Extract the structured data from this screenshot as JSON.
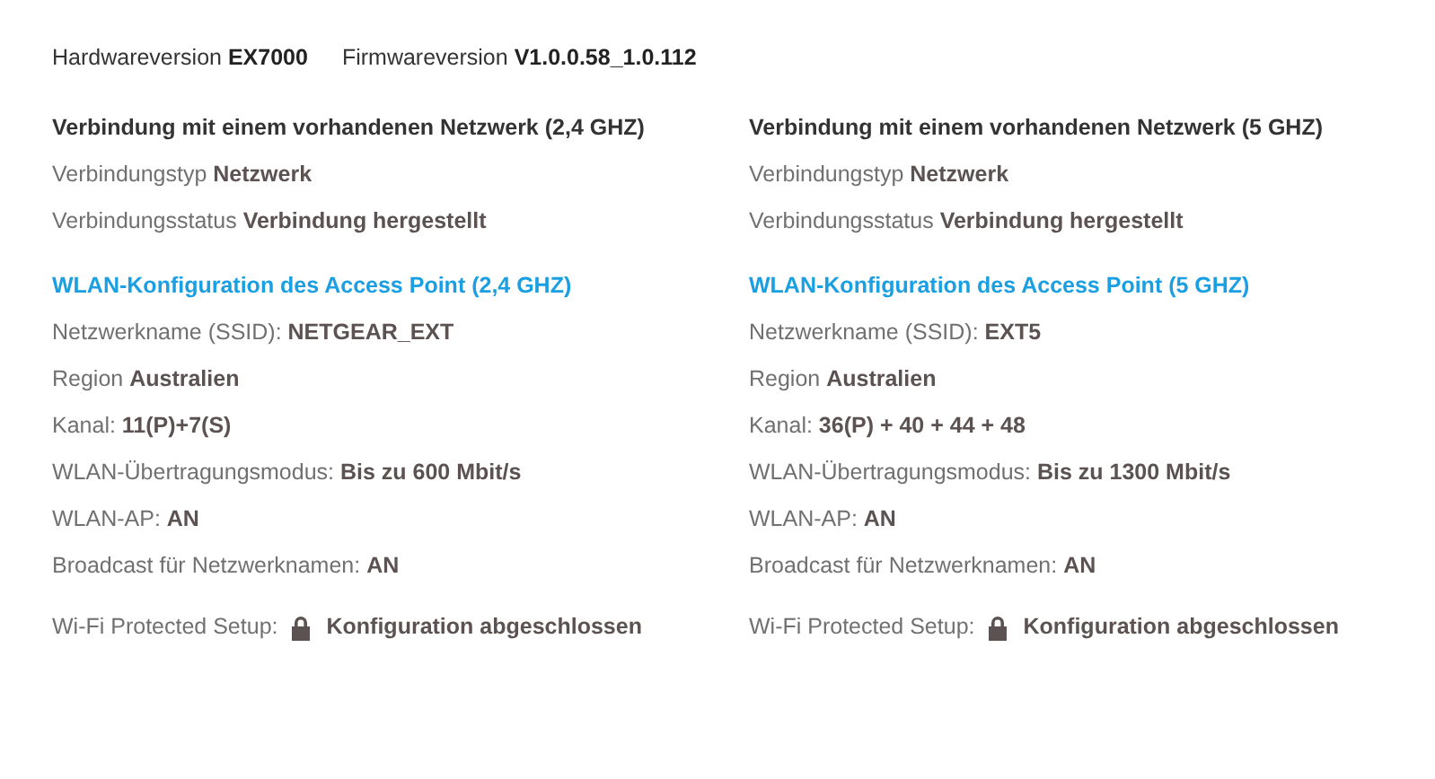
{
  "header": [
    {
      "text": "Hardwareversion **EX7000**"
    },
    {
      "text": "Firmwareversion **V1.0.0.58_1.0.112**"
    }
  ],
  "columns": [
    {
      "connection_title": "Verbindung mit einem vorhandenen Netzwerk (2,4 GHZ)",
      "connection_rows": [
        "Verbindungstyp **Netzwerk**",
        "Verbindungsstatus **Verbindung hergestellt**"
      ],
      "wlan_title": "WLAN-Konfiguration des Access Point (2,4 GHZ)",
      "wlan_rows": [
        "Netzwerkname (SSID): **NETGEAR_EXT**",
        "Region **Australien**",
        "Kanal: **11(P)+7(S)**",
        "WLAN-Übertragungsmodus: **Bis zu 600 Mbit/s**",
        "WLAN-AP: **AN**",
        "Broadcast für Netzwerknamen: **AN**"
      ],
      "wps": {
        "label": "Wi-Fi Protected Setup:",
        "value": "Konfiguration abgeschlossen"
      }
    },
    {
      "connection_title": "Verbindung mit einem vorhandenen Netzwerk (5 GHZ)",
      "connection_rows": [
        "Verbindungstyp **Netzwerk**",
        "Verbindungsstatus **Verbindung hergestellt**"
      ],
      "wlan_title": "WLAN-Konfiguration des Access Point (5 GHZ)",
      "wlan_rows": [
        "Netzwerkname (SSID): **EXT5**",
        "Region **Australien**",
        "Kanal: **36(P) + 40 + 44 + 48**",
        "WLAN-Übertragungsmodus: **Bis zu 1300 Mbit/s**",
        "WLAN-AP: **AN**",
        "Broadcast für Netzwerknamen: **AN**"
      ],
      "wps": {
        "label": "Wi-Fi Protected Setup:",
        "value": "Konfiguration abgeschlossen"
      }
    }
  ]
}
